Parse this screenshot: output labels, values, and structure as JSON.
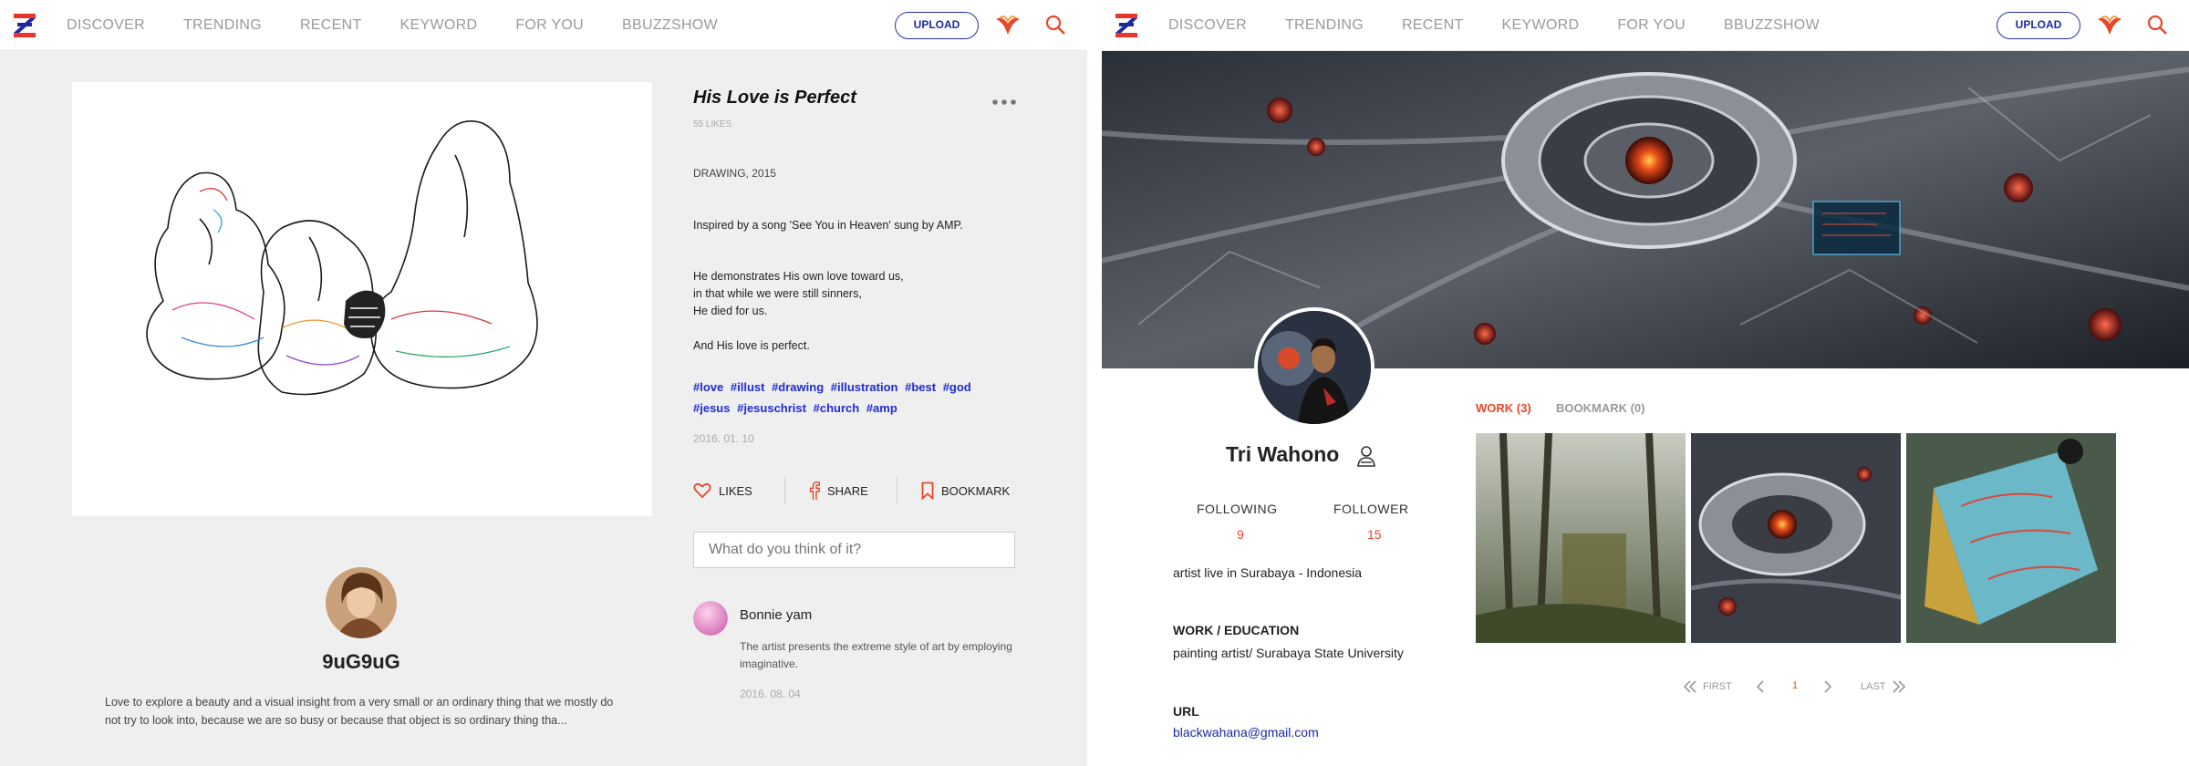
{
  "header": {
    "nav": [
      "DISCOVER",
      "TRENDING",
      "RECENT",
      "KEYWORD",
      "FOR YOU",
      "BBUZZSHOW"
    ],
    "upload_label": "UPLOAD"
  },
  "artwork_page": {
    "title": "His Love is Perfect",
    "likes_count": "55 LIKES",
    "meta": "DRAWING, 2015",
    "description": [
      "Inspired by a song 'See You in Heaven' sung by AMP.",
      "He demonstrates His own love toward us,",
      "in that while we were still sinners,",
      "He died for us.",
      "And His love is perfect."
    ],
    "tags": [
      "#love",
      "#illust",
      "#drawing",
      "#illustration",
      "#best",
      "#god",
      "#jesus",
      "#jesuschrist",
      "#church",
      "#amp"
    ],
    "date": "2016. 01. 10",
    "actions": {
      "likes": "LIKES",
      "share": "SHARE",
      "bookmark": "BOOKMARK"
    },
    "comment_placeholder": "What do you think of it?",
    "comment": {
      "author": "Bonnie yam",
      "text": "The artist presents the extreme style of art by employing imaginative.",
      "date": "2016. 08. 04"
    },
    "artist": {
      "username": "9uG9uG",
      "bio": "Love to explore a beauty and a visual insight from a very small or an ordinary thing that we mostly do not try to look into, because we are so busy or because that object is so ordinary thing tha..."
    }
  },
  "profile_page": {
    "name": "Tri Wahono",
    "following_label": "FOLLOWING",
    "following_count": "9",
    "follower_label": "FOLLOWER",
    "follower_count": "15",
    "about": "artist live in Surabaya - Indonesia",
    "work_label": "WORK / EDUCATION",
    "work_value": "painting artist/ Surabaya State University",
    "url_label": "URL",
    "url_value": "blackwahana@gmail.com",
    "tabs": {
      "work": "WORK (3)",
      "bookmark": "BOOKMARK (0)"
    },
    "pagination": {
      "first": "FIRST",
      "current": "1",
      "last": "LAST"
    }
  },
  "colors": {
    "accent_red": "#e8472a",
    "brand_blue": "#1c2aa0",
    "tag_blue": "#1f2bd1"
  },
  "icons": [
    "z-logo-icon",
    "phoenix-icon",
    "search-icon",
    "more-dots-icon",
    "heart-icon",
    "facebook-icon",
    "bookmark-icon",
    "person-icon",
    "double-chevron-left-icon",
    "chevron-left-icon",
    "chevron-right-icon",
    "double-chevron-right-icon"
  ]
}
